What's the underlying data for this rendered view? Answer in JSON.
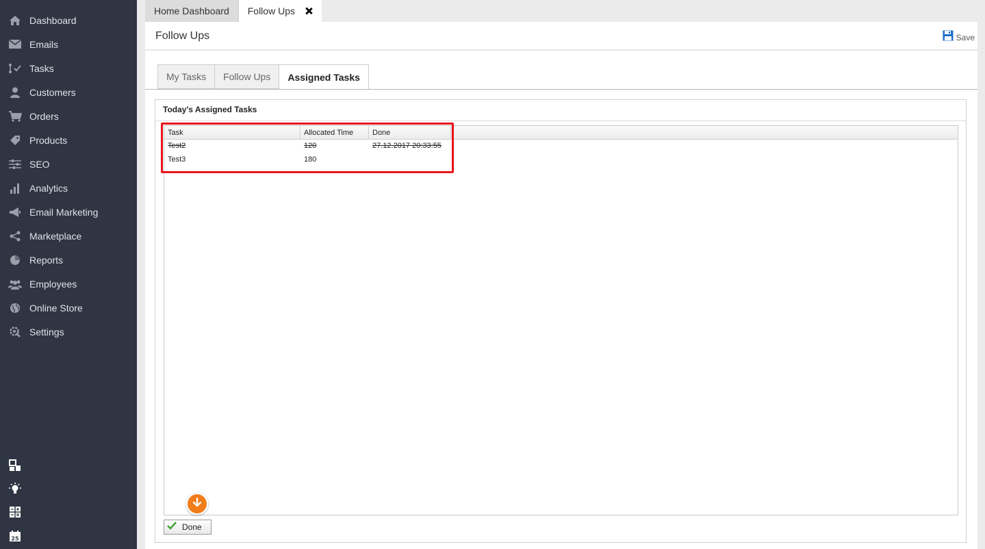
{
  "sidebar": {
    "items": [
      {
        "label": "Dashboard",
        "icon": "home-icon"
      },
      {
        "label": "Emails",
        "icon": "envelope-icon"
      },
      {
        "label": "Tasks",
        "icon": "tasks-icon"
      },
      {
        "label": "Customers",
        "icon": "user-icon"
      },
      {
        "label": "Orders",
        "icon": "cart-icon"
      },
      {
        "label": "Products",
        "icon": "tag-icon"
      },
      {
        "label": "SEO",
        "icon": "sliders-icon"
      },
      {
        "label": "Analytics",
        "icon": "bar-chart-icon"
      },
      {
        "label": "Email Marketing",
        "icon": "megaphone-icon"
      },
      {
        "label": "Marketplace",
        "icon": "share-icon"
      },
      {
        "label": "Reports",
        "icon": "pie-chart-icon"
      },
      {
        "label": "Employees",
        "icon": "users-icon"
      },
      {
        "label": "Online Store",
        "icon": "globe-icon"
      },
      {
        "label": "Settings",
        "icon": "gear-icon"
      }
    ],
    "bottom_icons": [
      "windows-icon",
      "lightbulb-icon",
      "calculator-icon",
      "calendar-icon"
    ],
    "calendar_day": "25"
  },
  "doc_tabs": [
    {
      "label": "Home Dashboard",
      "active": false
    },
    {
      "label": "Follow Ups",
      "active": true
    }
  ],
  "header": {
    "title": "Follow Ups",
    "save_label": "Save"
  },
  "sub_tabs": [
    {
      "label": "My Tasks",
      "active": false
    },
    {
      "label": "Follow Ups",
      "active": false
    },
    {
      "label": "Assigned Tasks",
      "active": true
    }
  ],
  "group": {
    "title": "Today's Assigned Tasks"
  },
  "grid": {
    "columns": [
      "Task",
      "Allocated Time",
      "Done"
    ],
    "rows": [
      {
        "task": "Test2",
        "allocated_time": "120",
        "done": "27.12.2017 20:33:55",
        "completed": true
      },
      {
        "task": "Test3",
        "allocated_time": "180",
        "done": "",
        "completed": false
      }
    ]
  },
  "actions": {
    "done_label": "Done"
  },
  "colors": {
    "sidebar_bg": "#2f3542",
    "highlight": "#e8131b",
    "fab": "#f07d1a",
    "check": "#3fa62f"
  }
}
